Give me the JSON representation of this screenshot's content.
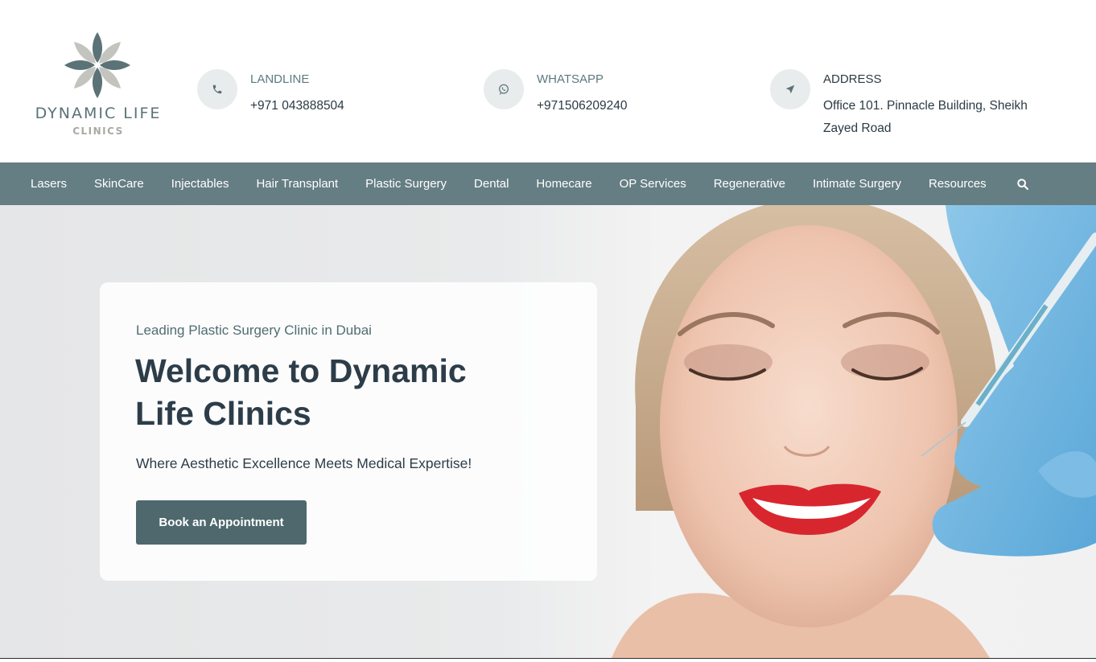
{
  "brand": {
    "name": "DYNAMIC LIFE",
    "sub": "CLINICS",
    "colors": {
      "petal_dark": "#5b7277",
      "petal_light": "#c4c4bf",
      "nav": "#657e83",
      "button": "#4e686d"
    }
  },
  "contacts": [
    {
      "icon": "phone-icon",
      "label": "LANDLINE",
      "value": "+971 043888504"
    },
    {
      "icon": "whatsapp-icon",
      "label": "WHATSAPP",
      "value": "+971506209240"
    },
    {
      "icon": "location-arrow-icon",
      "label": "ADDRESS",
      "value": "Office 101. Pinnacle Building, Sheikh Zayed Road"
    }
  ],
  "nav": {
    "items": [
      "Lasers",
      "SkinCare",
      "Injectables",
      "Hair Transplant",
      "Plastic Surgery",
      "Dental",
      "Homecare",
      "OP Services",
      "Regenerative",
      "Intimate Surgery",
      "Resources"
    ],
    "search_icon": "search-icon"
  },
  "hero": {
    "eyebrow": "Leading Plastic Surgery Clinic in Dubai",
    "title": "Welcome to Dynamic Life Clinics",
    "tagline": "Where Aesthetic Excellence Meets Medical Expertise!",
    "cta": "Book an Appointment"
  }
}
